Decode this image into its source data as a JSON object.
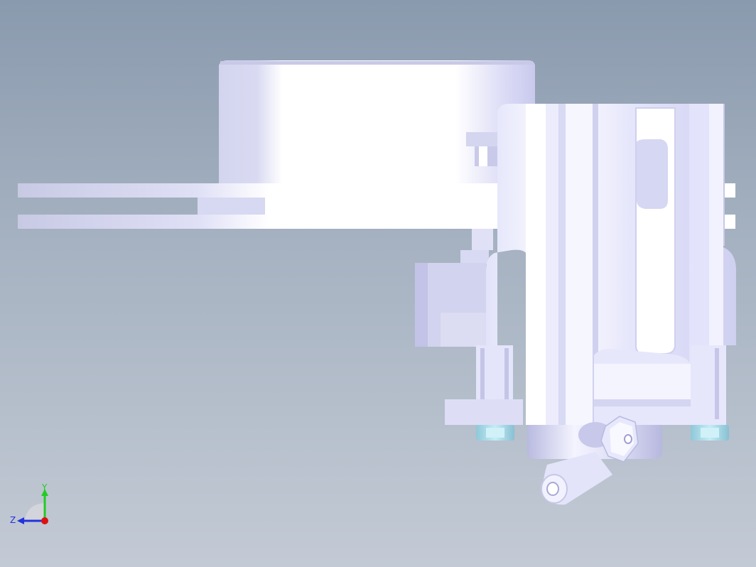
{
  "viewport": {
    "background_top": "#8a9aae",
    "background_bottom": "#c3cad5",
    "part_color": "#e9eafc",
    "part_shade": "#c6c7ea",
    "part_highlight": "#ffffff",
    "nut_color": "#a9dceb"
  },
  "triad": {
    "x_axis_label": "",
    "y_axis_label": "Y",
    "z_axis_label": "Z",
    "y_color": "#22cc22",
    "z_color": "#2233dd",
    "x_color": "#dd1111"
  }
}
